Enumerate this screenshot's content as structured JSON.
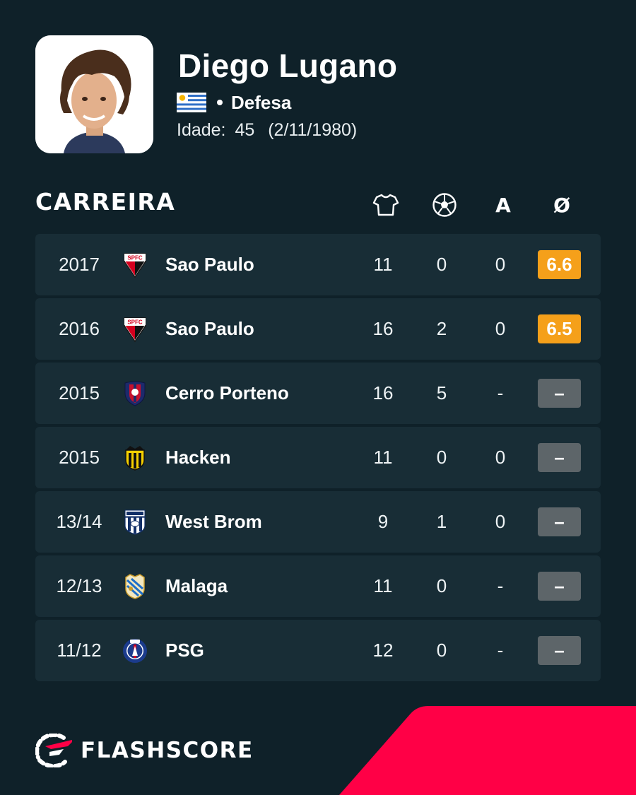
{
  "player": {
    "name": "Diego Lugano",
    "position": "Defesa",
    "age_label": "Idade:",
    "age": "45",
    "birth_date": "(2/11/1980)",
    "flag_icon": "uruguay-flag-icon"
  },
  "career": {
    "title": "CARREIRA",
    "columns": [
      {
        "icon": "jersey-icon",
        "meaning": ""
      },
      {
        "icon": "ball-icon",
        "meaning": ""
      },
      {
        "label": "A"
      },
      {
        "label": "Ø"
      }
    ],
    "rows": [
      {
        "season": "2017",
        "club": "Sao Paulo",
        "crest": "sao-paulo-crest-icon",
        "apps": "11",
        "goals": "0",
        "assists": "0",
        "rating": "6.6",
        "rating_state": "good"
      },
      {
        "season": "2016",
        "club": "Sao Paulo",
        "crest": "sao-paulo-crest-icon",
        "apps": "16",
        "goals": "2",
        "assists": "0",
        "rating": "6.5",
        "rating_state": "good"
      },
      {
        "season": "2015",
        "club": "Cerro Porteno",
        "crest": "cerro-porteno-crest-icon",
        "apps": "16",
        "goals": "5",
        "assists": "-",
        "rating": "–",
        "rating_state": "none"
      },
      {
        "season": "2015",
        "club": "Hacken",
        "crest": "hacken-crest-icon",
        "apps": "11",
        "goals": "0",
        "assists": "0",
        "rating": "–",
        "rating_state": "none"
      },
      {
        "season": "13/14",
        "club": "West Brom",
        "crest": "west-brom-crest-icon",
        "apps": "9",
        "goals": "1",
        "assists": "0",
        "rating": "–",
        "rating_state": "none"
      },
      {
        "season": "12/13",
        "club": "Malaga",
        "crest": "malaga-crest-icon",
        "apps": "11",
        "goals": "0",
        "assists": "-",
        "rating": "–",
        "rating_state": "none"
      },
      {
        "season": "11/12",
        "club": "PSG",
        "crest": "psg-crest-icon",
        "apps": "12",
        "goals": "0",
        "assists": "-",
        "rating": "–",
        "rating_state": "none"
      }
    ]
  },
  "footer": {
    "brand": "FLASHSCORE",
    "brand_icon": "flashscore-logo-icon"
  },
  "colors": {
    "background": "#0f2129",
    "row_background": "#182d36",
    "rating_good": "#f5a01a",
    "rating_none": "#5d6569",
    "accent": "#ff0046"
  }
}
